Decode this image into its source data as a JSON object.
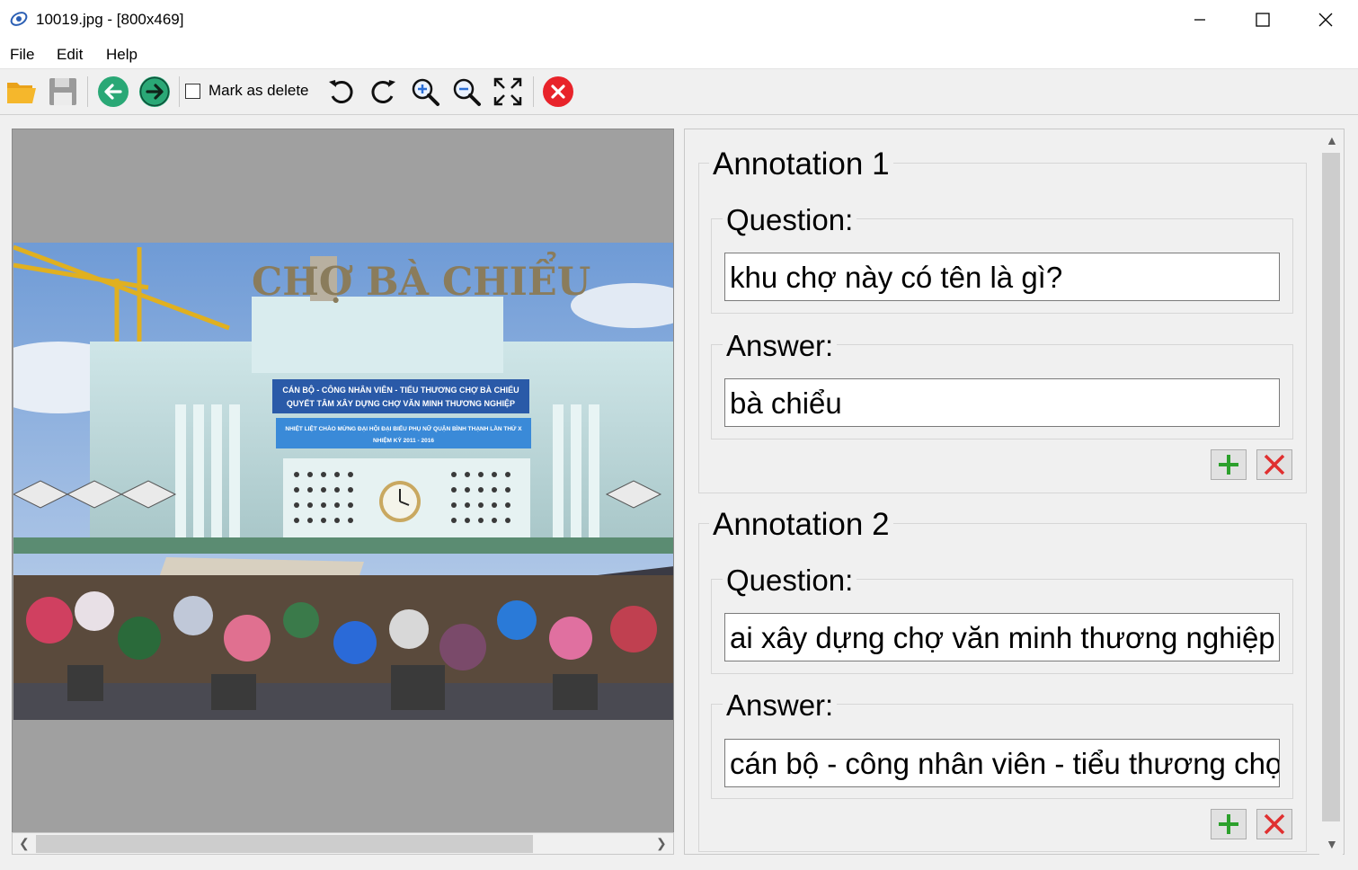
{
  "window": {
    "title": "10019.jpg - [800x469]"
  },
  "menu": {
    "file": "File",
    "edit": "Edit",
    "help": "Help"
  },
  "toolbar": {
    "mark_delete_label": "Mark as delete",
    "mark_delete_checked": false
  },
  "image": {
    "sign_name": "CHỢ BÀ CHIỂU",
    "banner_line1": "CÁN BỘ - CÔNG NHÂN VIÊN - TIỂU THƯƠNG CHỢ BÀ CHIỂU",
    "banner_line2": "QUYẾT TÂM XÂY DỰNG CHỢ VĂN MINH THƯƠNG NGHIỆP",
    "banner2_line1": "NHIỆT LIỆT CHÀO MỪNG ĐẠI HỘI ĐẠI BIỂU PHỤ NỮ QUẬN BÌNH THẠNH LẦN THỨ X",
    "banner2_line2": "NHIỆM KỲ 2011 - 2016"
  },
  "annotations": [
    {
      "title": "Annotation 1",
      "question_label": "Question:",
      "question": "khu chợ này có tên là gì?",
      "answer_label": "Answer:",
      "answer": "bà chiểu"
    },
    {
      "title": "Annotation 2",
      "question_label": "Question:",
      "question": "ai xây dựng chợ văn minh thương nghiệp",
      "answer_label": "Answer:",
      "answer": "cán bộ - công nhân viên - tiểu thương chợ bà chiểu"
    }
  ],
  "colors": {
    "nav_green": "#2aa876",
    "close_red": "#e8232a",
    "add_green": "#2ca02c",
    "remove_red": "#e03030"
  }
}
